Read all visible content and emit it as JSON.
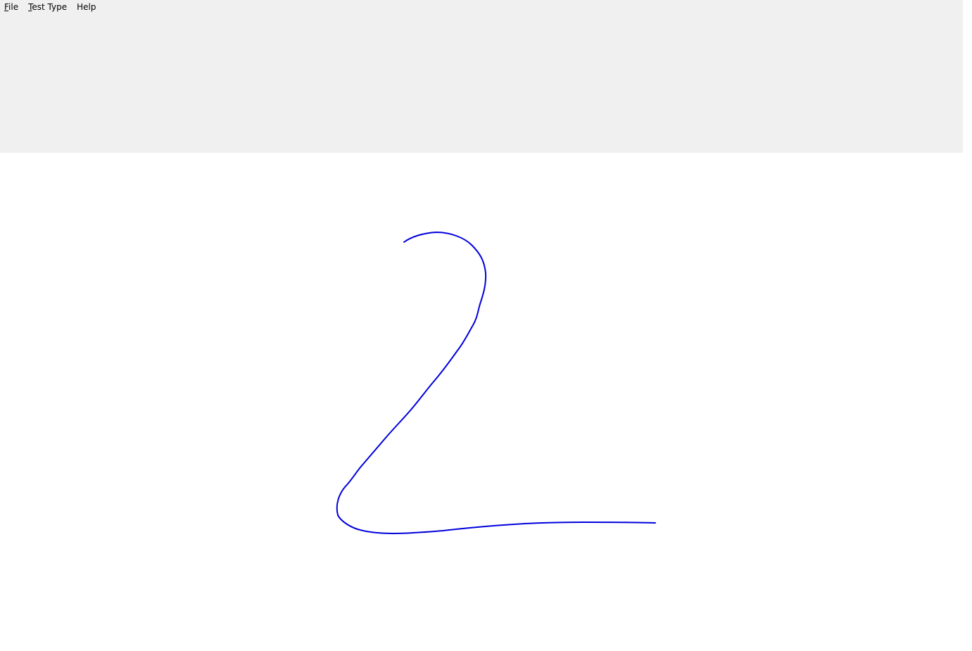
{
  "menubar": {
    "items": [
      {
        "mnemonic": "F",
        "rest": "ile"
      },
      {
        "mnemonic": "T",
        "rest": "est Type"
      },
      {
        "mnemonic": "",
        "rest": "Help"
      }
    ]
  },
  "drawing": {
    "stroke_color": "#0000dd",
    "description_icon": "ink-stroke"
  }
}
